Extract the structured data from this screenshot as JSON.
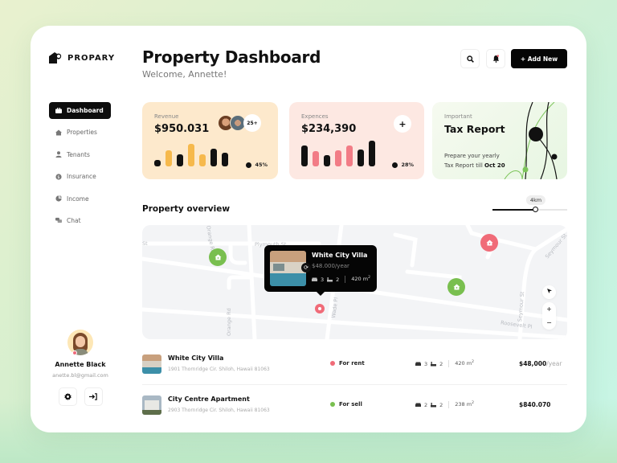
{
  "brand": {
    "name": "PROPARY"
  },
  "header": {
    "title": "Property Dashboard",
    "welcome": "Welcome, Annette!",
    "add_label": "+ Add New",
    "search_icon": "search-icon",
    "bell_icon": "bell-icon"
  },
  "sidebar": {
    "items": [
      {
        "label": "Dashboard",
        "icon": "briefcase-icon",
        "active": true
      },
      {
        "label": "Properties",
        "icon": "home-icon",
        "active": false
      },
      {
        "label": "Tenants",
        "icon": "user-icon",
        "active": false
      },
      {
        "label": "Insurance",
        "icon": "shield-icon",
        "active": false
      },
      {
        "label": "Income",
        "icon": "pie-chart-icon",
        "active": false
      },
      {
        "label": "Chat",
        "icon": "chat-icon",
        "active": false
      }
    ]
  },
  "profile": {
    "name": "Annette Black",
    "email": "anette.bl@gmail.com"
  },
  "stats": {
    "revenue": {
      "label": "Revenue",
      "value": "$950.031",
      "more": "25+",
      "percent": "45%",
      "bars": [
        0.3,
        0.72,
        0.55,
        1.0,
        0.55,
        0.78,
        0.6
      ],
      "bar_colors": [
        "#111111",
        "#f6b94c",
        "#111111",
        "#f6b94c",
        "#f6b94c",
        "#111111",
        "#111111"
      ]
    },
    "expenses": {
      "label": "Expences",
      "value": "$234,390",
      "plus": "+",
      "percent": "28%",
      "bars": [
        0.82,
        0.6,
        0.45,
        0.64,
        0.8,
        0.66,
        1.0
      ],
      "bar_colors": [
        "#111111",
        "#f27c86",
        "#111111",
        "#f27c86",
        "#f27c86",
        "#111111",
        "#111111"
      ]
    },
    "tax": {
      "label": "Important",
      "title": "Tax Report",
      "desc_line1": "Prepare your yearly",
      "desc_line2": "Tax Report till ",
      "desc_date": "Oct 20"
    }
  },
  "overview": {
    "title": "Property overview",
    "radius_label": "4km",
    "radius_fraction": 0.58
  },
  "map": {
    "roads": [
      "Plymouth St",
      "Orange Rd",
      "Orange Rd",
      "Wade Pl",
      "Seymour St",
      "Seymour St",
      "Roosevelt Pl",
      "St"
    ],
    "zoom_in": "+",
    "zoom_out": "−",
    "popup": {
      "title": "White City Villa",
      "price": "$48.000/year",
      "beds": "3",
      "baths": "2",
      "area": "420 m",
      "area_sup": "2"
    }
  },
  "properties": [
    {
      "title": "White City Villa",
      "address": "1901 Thornridge Cir. Shiloh, Hawaii 81063",
      "status": "For rent",
      "status_color": "#f06b78",
      "beds": "3",
      "baths": "2",
      "area": "420 m",
      "area_sup": "2",
      "price": "$48,000",
      "price_suffix": "/year"
    },
    {
      "title": "City Centre Apartment",
      "address": "2903 Thornridge Cir. Shiloh, Hawaii 81063",
      "status": "For sell",
      "status_color": "#79bf4f",
      "beds": "2",
      "baths": "2",
      "area": "238 m",
      "area_sup": "2",
      "price": "$840.070",
      "price_suffix": ""
    }
  ]
}
